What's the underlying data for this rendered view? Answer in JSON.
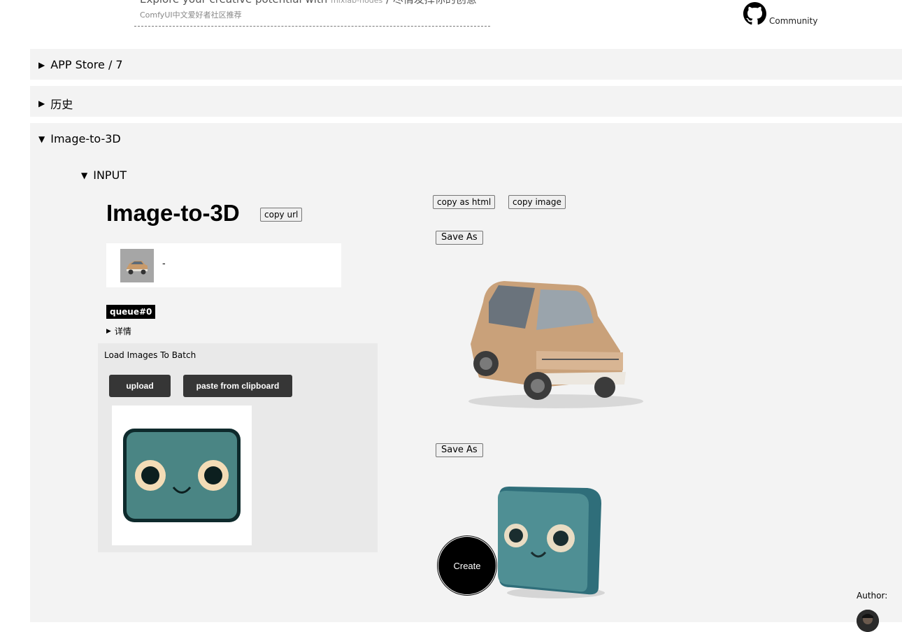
{
  "header": {
    "tagline_prefix": "Explore your creative potential with",
    "tagline_nodes": "mixlab-nodes",
    "tagline_cn": " / 尽情发挥你的创意",
    "subtitle": "ComfyUI中文爱好者社区推荐",
    "community_label": "Community",
    "github_icon": "github-icon"
  },
  "panels": {
    "app_store": {
      "triangle": "▶",
      "label": "APP Store / 7"
    },
    "history": {
      "triangle": "▶",
      "label": "历史"
    },
    "image_to_3d": {
      "triangle": "▼",
      "label": "Image-to-3D"
    }
  },
  "input_section": {
    "triangle": "▼",
    "label": "INPUT",
    "title": "Image-to-3D",
    "copy_url_label": "copy url",
    "thumb_label": "-",
    "queue_label": "queue#0",
    "details_triangle": "▶",
    "details_label": "详情"
  },
  "load_images": {
    "title": "Load Images To Batch",
    "upload_label": "upload",
    "paste_label": "paste from clipboard"
  },
  "output": {
    "copy_html_label": "copy as html",
    "copy_image_label": "copy image",
    "save_as_label_1": "Save As",
    "save_as_label_2": "Save As"
  },
  "actions": {
    "create_label": "Create"
  },
  "footer": {
    "author_label": "Author:"
  },
  "colors": {
    "panel_bg": "#f3f3f3",
    "dark_button": "#363636",
    "queue_badge": "#000000"
  }
}
